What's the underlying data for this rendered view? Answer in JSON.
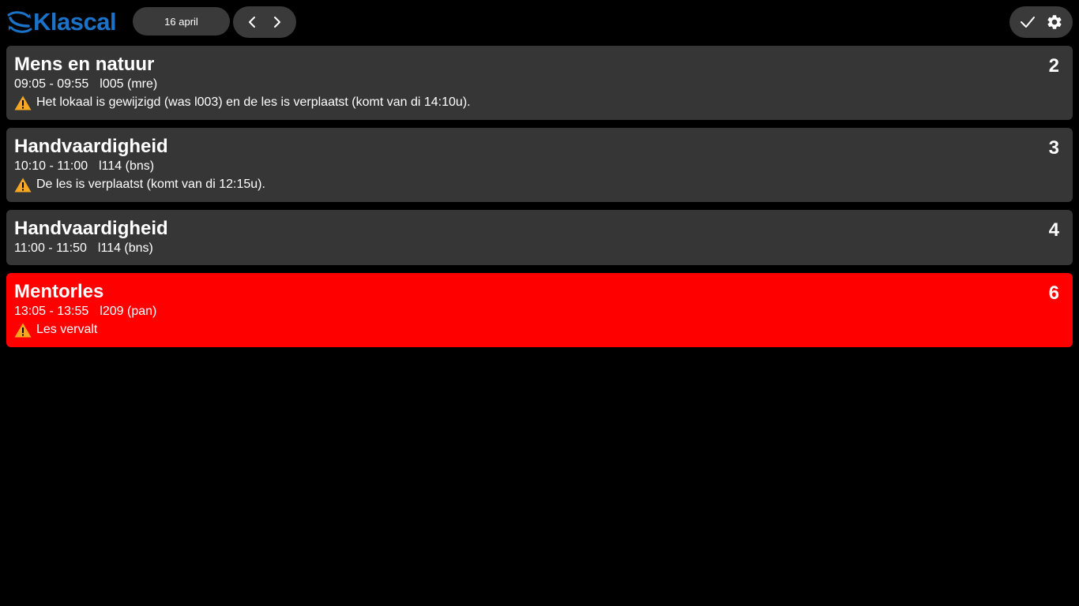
{
  "app": {
    "logo_text": "Klascal",
    "brand_color": "#1a73c8"
  },
  "header": {
    "date": "16 april",
    "prev_icon": "chevron-left-icon",
    "next_icon": "chevron-right-icon",
    "check_icon": "check-icon",
    "settings_icon": "gear-icon"
  },
  "colors": {
    "card_bg": "#363636",
    "cancelled_bg": "#ff0000",
    "warning": "#f5a623"
  },
  "lessons": [
    {
      "title": "Mens en natuur",
      "period": "2",
      "time": "09:05 - 09:55",
      "room": "l005 (mre)",
      "warning": "Het lokaal is gewijzigd (was l003) en de les is verplaatst (komt van di 14:10u).",
      "cancelled": false
    },
    {
      "title": "Handvaardigheid",
      "period": "3",
      "time": "10:10 - 11:00",
      "room": "l114 (bns)",
      "warning": "De les is verplaatst (komt van di 12:15u).",
      "cancelled": false
    },
    {
      "title": "Handvaardigheid",
      "period": "4",
      "time": "11:00 - 11:50",
      "room": "l114 (bns)",
      "warning": "",
      "cancelled": false
    },
    {
      "title": "Mentorles",
      "period": "6",
      "time": "13:05 - 13:55",
      "room": "l209 (pan)",
      "warning": "Les vervalt",
      "cancelled": true
    }
  ]
}
